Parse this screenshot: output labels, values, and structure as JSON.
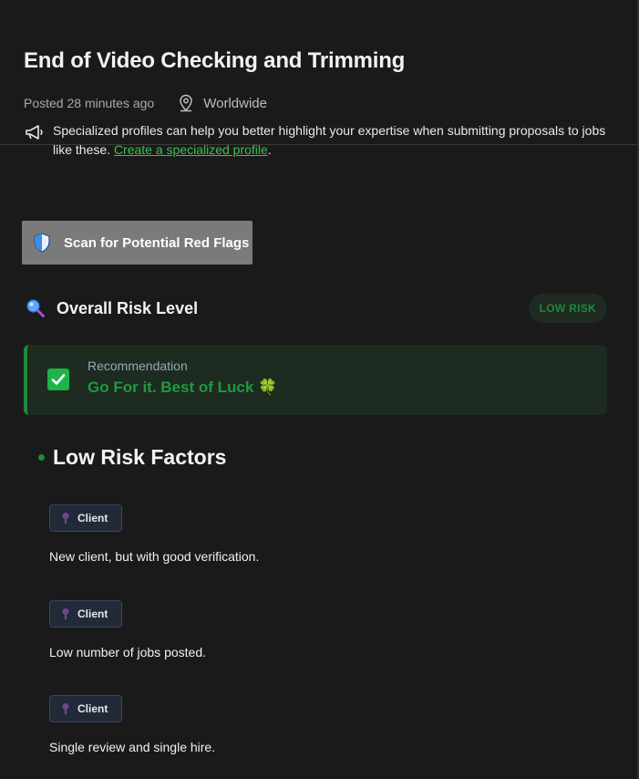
{
  "job": {
    "title": "End of Video Checking and Trimming",
    "posted": "Posted 28 minutes ago",
    "location": "Worldwide",
    "promo_text": "Specialized profiles can help you better highlight your expertise when submitting proposals to jobs like these.",
    "promo_link": "Create a specialized profile",
    "promo_end": "."
  },
  "scan": {
    "button_label": "Scan for Potential Red Flags"
  },
  "risk": {
    "label": "Overall Risk Level",
    "badge": "LOW RISK",
    "recommendation_label": "Recommendation",
    "recommendation_value": "Go For it. Best of Luck 🍀"
  },
  "factors": {
    "title": "Low Risk Factors",
    "items": [
      {
        "tag": "Client",
        "text": "New client, but with good verification."
      },
      {
        "tag": "Client",
        "text": "Low number of jobs posted."
      },
      {
        "tag": "Client",
        "text": "Single review and single hire."
      }
    ]
  },
  "colors": {
    "accent_green": "#1f8a3a",
    "link_green": "#3fbf52",
    "background": "#1a1a1a"
  },
  "icons": [
    "location-pin-icon",
    "megaphone-icon",
    "shield-icon",
    "magnifier-icon",
    "checkbox-icon",
    "pin-icon"
  ]
}
